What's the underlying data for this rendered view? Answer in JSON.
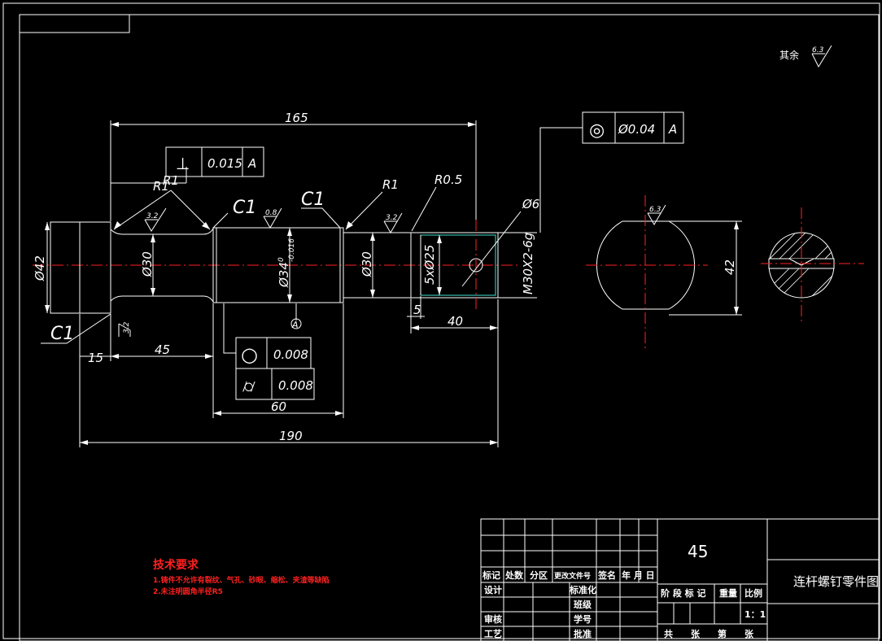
{
  "roughness_note": {
    "label": "其余",
    "value": "6.3"
  },
  "dimensions": {
    "len_165": "165",
    "len_190": "190",
    "len_60": "60",
    "len_45": "45",
    "len_15": "15",
    "len_40": "40",
    "len_5": "5",
    "dia_42": "Ø42",
    "dia_30_left": "Ø30",
    "dia_34": "Ø34",
    "dia_34_tol_upper": "0",
    "dia_34_tol_lower": "-0.016",
    "dia_30_right": "Ø30",
    "dia_25": "5xØ25",
    "thread": "M30X2-6g",
    "hole_6": "Ø6",
    "section_42": "42",
    "r_left_a": "R1",
    "r_left_b": "R1",
    "r_right": "R1",
    "r_05": "R0.5",
    "c1_left": "C1",
    "c1_mid_a": "C1",
    "c1_mid_b": "C1",
    "datum_a": "A"
  },
  "roughness": {
    "r_left": "3.2",
    "r_mid": "0.8",
    "r_right": "3.2",
    "r_bottom": "3.2",
    "r_section": "6.3"
  },
  "tolerance_frames": {
    "perp": {
      "symbol": "⊥",
      "value": "0.015",
      "datum": "A"
    },
    "conc": {
      "symbol": "◎",
      "value": "Ø0.04",
      "datum": "A"
    },
    "circ": {
      "symbol": "○",
      "value": "0.008"
    },
    "cyl": {
      "symbol": "⌭",
      "value": "0.008"
    }
  },
  "tech_requirements": {
    "title": "技术要求",
    "line1": "1.铸件不允许有裂纹、气孔、砂眼、缩松、夹渣等缺陷",
    "line2": "2.未注明圆角半径R5"
  },
  "title_block": {
    "material": "45",
    "drawing_name": "连杆螺钉零件图",
    "h_mark": "标记",
    "h_count": "处数",
    "h_zone": "分区",
    "h_doc": "更改文件号",
    "h_sign": "签名",
    "h_date": "年 月 日",
    "design": "设计",
    "standard": "标准化",
    "review": "审核",
    "craft": "工艺",
    "class_label": "班级",
    "student_id": "学号",
    "approve": "批准",
    "stage": "阶 段 标 记",
    "weight": "重量",
    "scale_label": "比例",
    "scale_value": "1：1",
    "sheets": "共　　张　　第　　张"
  }
}
